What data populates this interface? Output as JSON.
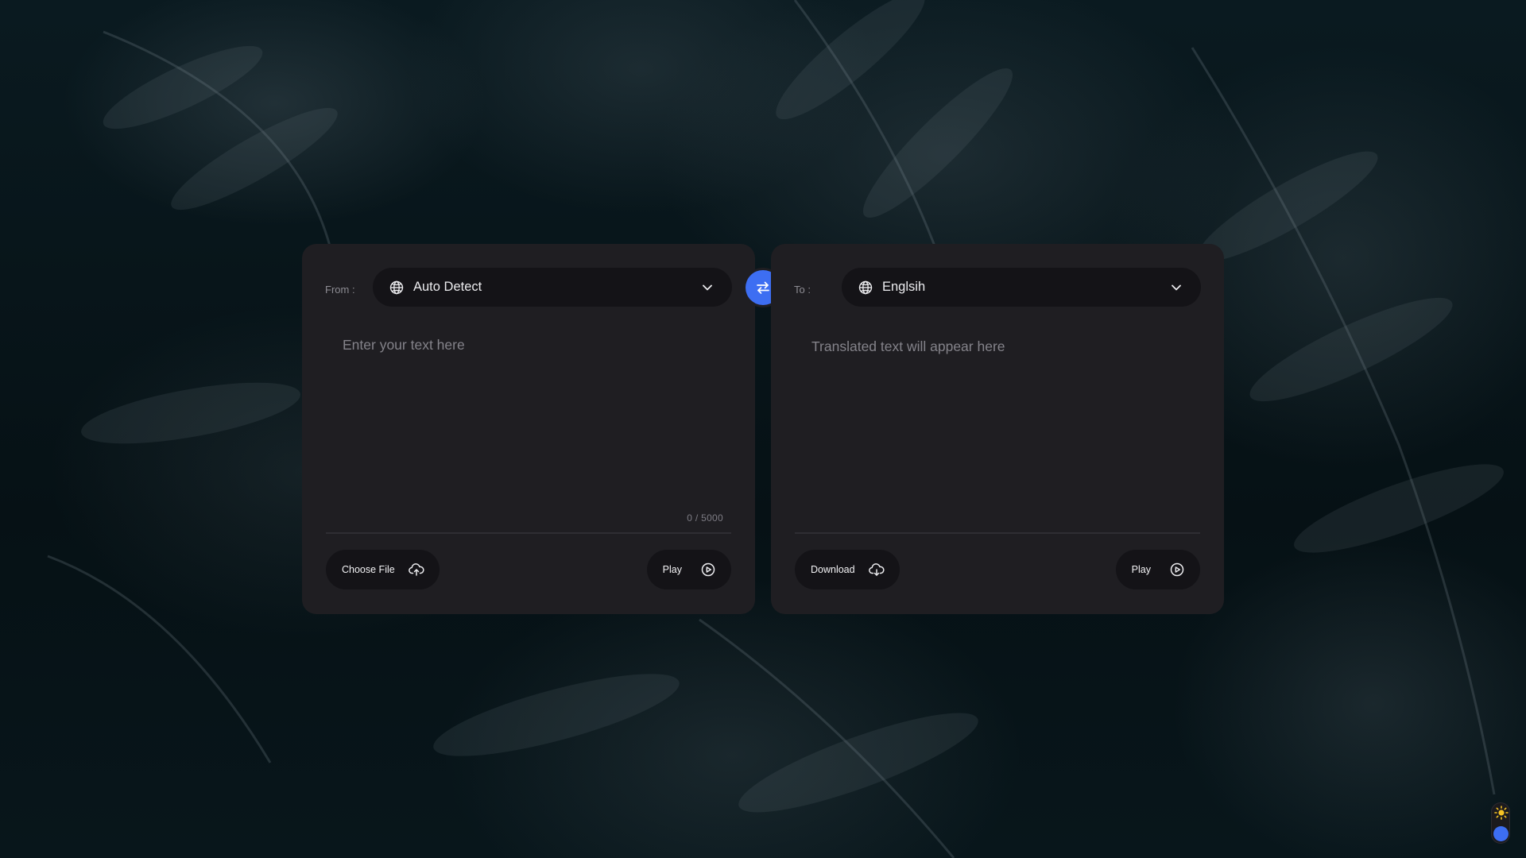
{
  "colors": {
    "accent": "#3d6ef2",
    "card_bg": "#1f1e22",
    "control_bg": "#141317",
    "sun": "#f6c324"
  },
  "source": {
    "label": "From :",
    "language": "Auto Detect",
    "placeholder": "Enter your text here",
    "value": "",
    "counter": "0 / 5000",
    "upload_label": "Choose File",
    "play_label": "Play"
  },
  "target": {
    "label": "To :",
    "language": "Englsih",
    "placeholder": "Translated text will appear here",
    "download_label": "Download",
    "play_label": "Play"
  },
  "icons": {
    "globe": "globe-icon",
    "chevron": "chevron-down-icon",
    "swap": "swap-arrows-icon",
    "upload": "cloud-upload-icon",
    "download": "cloud-download-icon",
    "play": "play-circle-icon",
    "sun": "sun-icon"
  },
  "theme_toggle": {
    "state": "dark"
  }
}
